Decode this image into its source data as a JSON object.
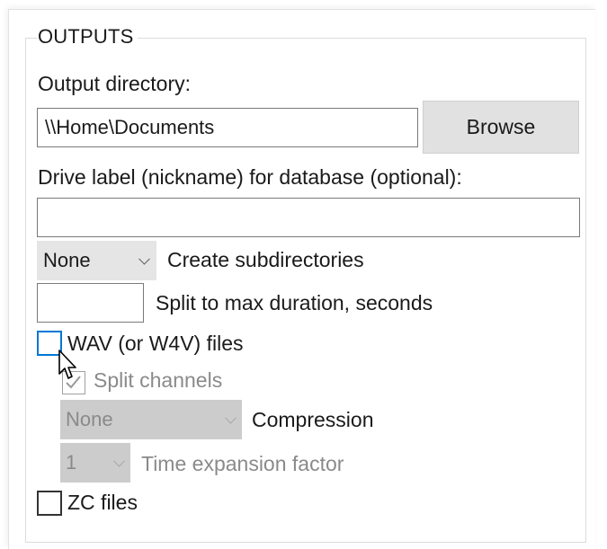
{
  "outputs": {
    "group_title": "OUTPUTS",
    "output_dir_label": "Output directory:",
    "output_dir_value": "\\\\Home\\Documents",
    "browse_label": "Browse",
    "drive_label_label": "Drive label (nickname) for database (optional):",
    "drive_label_value": "",
    "subdir_select_value": "None",
    "subdir_label": "Create subdirectories",
    "split_duration_value": "",
    "split_duration_label": "Split to max duration, seconds",
    "wav_checkbox_label": "WAV (or W4V) files",
    "wav_checked": false,
    "split_channels_label": "Split channels",
    "split_channels_checked": true,
    "compression_select_value": "None",
    "compression_label": "Compression",
    "time_expansion_select_value": "1",
    "time_expansion_label": "Time expansion factor",
    "zc_checkbox_label": "ZC files",
    "zc_checked": false
  },
  "colors": {
    "accent_focus": "#0078d7",
    "disabled_text": "#8a8a8a",
    "button_bg": "#e1e1e1"
  },
  "icons": {
    "cursor": "arrow-pointer-icon",
    "checkmark": "checkmark-icon",
    "chevron": "chevron-down-icon"
  }
}
